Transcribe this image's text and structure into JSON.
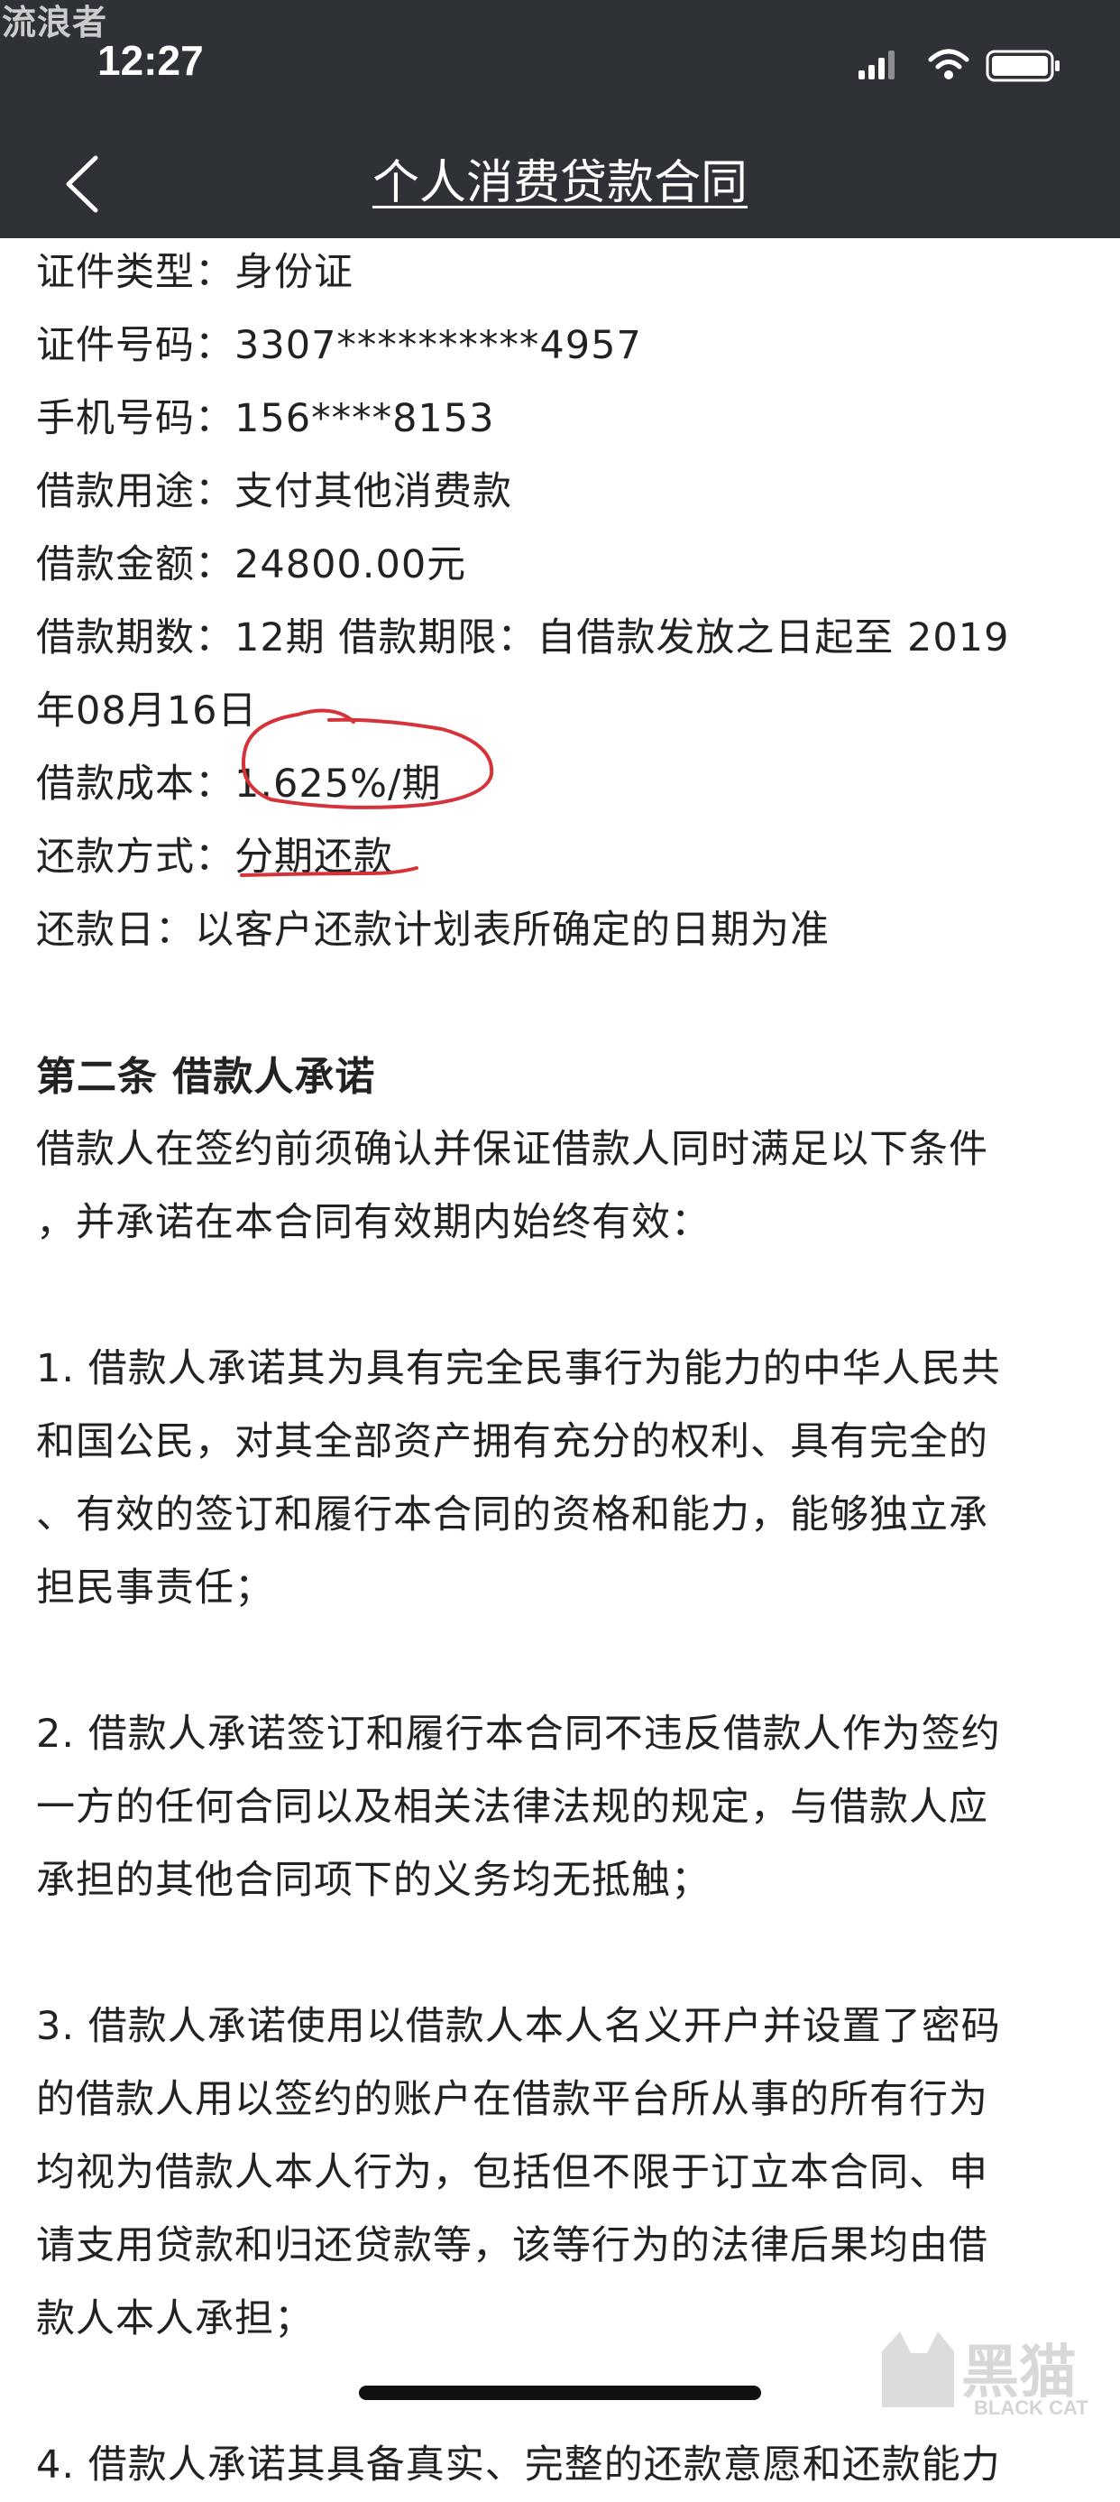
{
  "status_bar": {
    "watermark": "流浪者",
    "time": "12:27"
  },
  "nav": {
    "title": "个人消费贷款合同",
    "back_icon": "chevron-left-icon"
  },
  "contract": {
    "lines": [
      "证件类型：身份证",
      "证件号码：3307**********4957",
      "手机号码：156****8153",
      "借款用途：支付其他消费款",
      "借款金额：24800.00元",
      "借款期数：12期 借款期限：自借款发放之日起至 2019",
      "年08月16日",
      "借款成本：1.625%/期",
      "还款方式：分期还款",
      "还款日：以客户还款计划表所确定的日期为准",
      "",
      "第二条 借款人承诺",
      "借款人在签约前须确认并保证借款人同时满足以下条件",
      "，并承诺在本合同有效期内始终有效：",
      "",
      "1. 借款人承诺其为具有完全民事行为能力的中华人民共",
      "和国公民，对其全部资产拥有充分的权利、具有完全的",
      "、有效的签订和履行本合同的资格和能力，能够独立承",
      "担民事责任；",
      "",
      "2. 借款人承诺签订和履行本合同不违反借款人作为签约",
      "一方的任何合同以及相关法律法规的规定，与借款人应",
      "承担的其他合同项下的义务均无抵触；",
      "",
      "3. 借款人承诺使用以借款人本人名义开户并设置了密码",
      "的借款人用以签约的账户在借款平台所从事的所有行为",
      "均视为借款人本人行为，包括但不限于订立本合同、申",
      "请支用贷款和归还贷款等，该等行为的法律后果均由借",
      "款人本人承担；",
      "",
      "4. 借款人承诺其具备真实、完整的还款意愿和还款能力"
    ]
  },
  "watermark_br": {
    "text": "黑猫",
    "subtext": "BLACK CAT"
  },
  "colors": {
    "header_bg": "#2e3236",
    "annotation": "#d6323a"
  }
}
